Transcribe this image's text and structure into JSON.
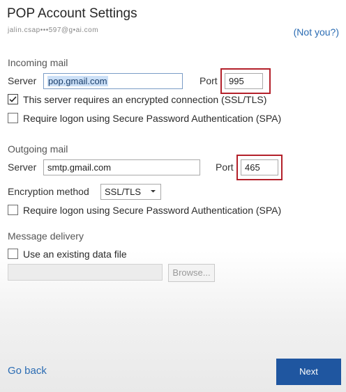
{
  "dialog": {
    "title": "POP Account Settings",
    "email": "jalin.csap•••597@g•ai.com",
    "not_you": "(Not you?)"
  },
  "incoming": {
    "section_label": "Incoming mail",
    "server_label": "Server",
    "server_value": "pop.gmail.com",
    "port_label": "Port",
    "port_value": "995",
    "ssl_checkbox": {
      "label": "This server requires an encrypted connection (SSL/TLS)",
      "checked": true
    },
    "spa_checkbox": {
      "label": "Require logon using Secure Password Authentication (SPA)",
      "checked": false
    }
  },
  "outgoing": {
    "section_label": "Outgoing mail",
    "server_label": "Server",
    "server_value": "smtp.gmail.com",
    "port_label": "Port",
    "port_value": "465",
    "encryption_label": "Encryption method",
    "encryption_value": "SSL/TLS",
    "spa_checkbox": {
      "label": "Require logon using Secure Password Authentication (SPA)",
      "checked": false
    }
  },
  "delivery": {
    "section_label": "Message delivery",
    "existing_file_checkbox": {
      "label": "Use an existing data file",
      "checked": false
    },
    "file_path_value": "",
    "browse_label": "Browse..."
  },
  "footer": {
    "go_back": "Go back",
    "next": "Next"
  },
  "colors": {
    "accent_blue": "#1f56a0",
    "link_blue": "#2b6cb3",
    "highlight_red": "#b3202a"
  }
}
